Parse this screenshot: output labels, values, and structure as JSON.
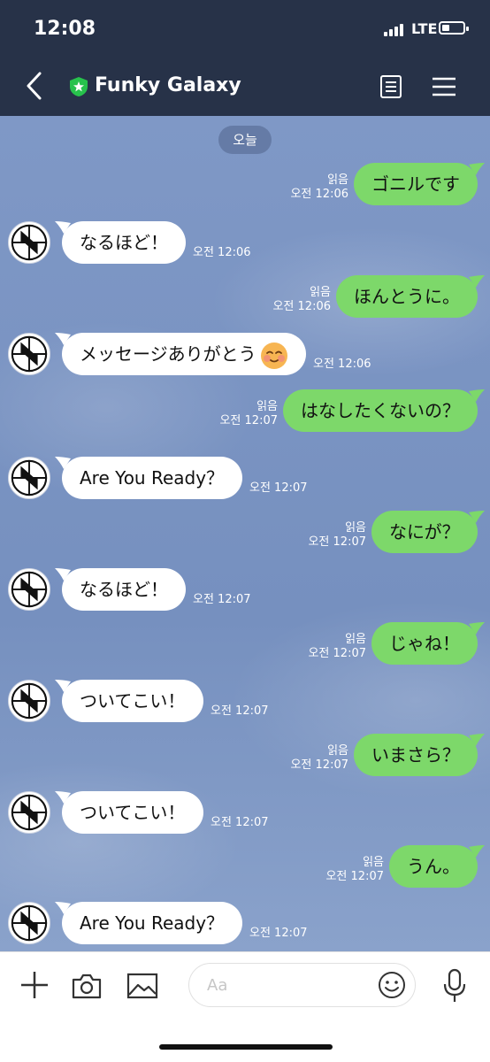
{
  "status": {
    "time": "12:08",
    "network": "LTE"
  },
  "header": {
    "title": "Funky Galaxy",
    "back_icon": "back-chevron-icon",
    "notes_icon": "notes-icon",
    "menu_icon": "menu-icon",
    "shield_color": "#27c24c"
  },
  "date_label": "오늘",
  "messages": [
    {
      "side": "out",
      "text": "ゴニルです",
      "read": "읽음",
      "time": "오전 12:06"
    },
    {
      "side": "in",
      "text": "なるほど！",
      "time": "오전 12:06"
    },
    {
      "side": "out",
      "text": "ほんとうに。",
      "read": "읽음",
      "time": "오전 12:06"
    },
    {
      "side": "in",
      "text": "メッセージありがとう",
      "time": "오전 12:06",
      "emoji": "blushing-face-emoji"
    },
    {
      "side": "out",
      "text": "はなしたくないの？",
      "read": "읽음",
      "time": "오전 12:07"
    },
    {
      "side": "in",
      "text": "Are You Ready？",
      "time": "오전 12:07"
    },
    {
      "side": "out",
      "text": "なにが？",
      "read": "읽음",
      "time": "오전 12:07"
    },
    {
      "side": "in",
      "text": "なるほど！",
      "time": "오전 12:07"
    },
    {
      "side": "out",
      "text": "じゃね！",
      "read": "읽음",
      "time": "오전 12:07"
    },
    {
      "side": "in",
      "text": "ついてこい！",
      "time": "오전 12:07"
    },
    {
      "side": "out",
      "text": "いまさら？",
      "read": "읽음",
      "time": "오전 12:07"
    },
    {
      "side": "in",
      "text": "ついてこい！",
      "time": "오전 12:07"
    },
    {
      "side": "out",
      "text": "うん。",
      "read": "읽음",
      "time": "오전 12:07"
    },
    {
      "side": "in",
      "text": "Are You Ready？",
      "time": "오전 12:07"
    }
  ],
  "input": {
    "placeholder": "Aa"
  },
  "colors": {
    "header_bg": "#273248",
    "chat_bg": "#7c96c3",
    "outgoing_bubble": "#7dd86a",
    "incoming_bubble": "#ffffff"
  }
}
